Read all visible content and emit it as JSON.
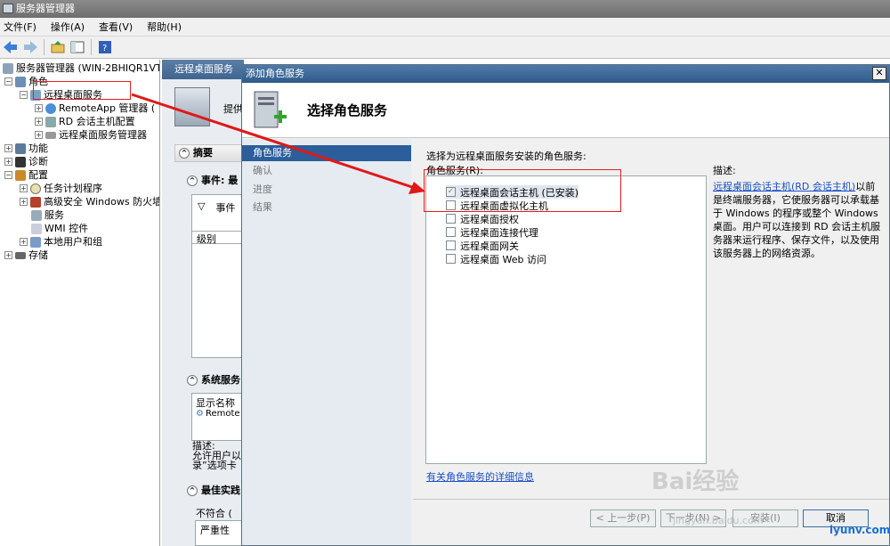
{
  "window": {
    "title": "服务器管理器"
  },
  "menu": [
    "文件(F)",
    "操作(A)",
    "查看(V)",
    "帮助(H)"
  ],
  "tree": {
    "root": "服务器管理器 (WIN-2BHIQR1VTC",
    "roles": "角色",
    "rds": "远程桌面服务",
    "remoteapp": "RemoteApp 管理器 (",
    "rdconfig": "RD 会话主机配置",
    "rdsmgr": "远程桌面服务管理器",
    "features": "功能",
    "diagnostics": "诊断",
    "config": "配置",
    "tasks": "任务计划程序",
    "firewall": "高级安全 Windows 防火墙",
    "services": "服务",
    "wmi": "WMI 控件",
    "localusers": "本地用户和组",
    "storage": "存储"
  },
  "middle": {
    "header": "远程桌面服务",
    "provide": "提供",
    "summary": "摘要",
    "events": "事件: 最",
    "events_filter": "事件",
    "level_col": "级别",
    "system_services": "系统服务",
    "display_name_col": "显示名称",
    "remote_item": "Remote",
    "desc_label": "描述:",
    "desc_line1": "允许用户以",
    "desc_line2": "录”选项卡",
    "best_practices": "最佳实践",
    "noncompliant": "不符合 (",
    "severity_col": "严重性"
  },
  "dialog": {
    "title": "添加角色服务",
    "header": "选择角色服务",
    "steps": [
      "角色服务",
      "确认",
      "进度",
      "结果"
    ],
    "instruction": "选择为远程桌面服务安装的角色服务:",
    "list_label": "角色服务(R):",
    "role_services": [
      {
        "label": "远程桌面会话主机 (已安装)",
        "checked": true,
        "disabled": true
      },
      {
        "label": "远程桌面虚拟化主机",
        "checked": false,
        "disabled": false
      },
      {
        "label": "远程桌面授权",
        "checked": false,
        "disabled": false
      },
      {
        "label": "远程桌面连接代理",
        "checked": false,
        "disabled": false
      },
      {
        "label": "远程桌面网关",
        "checked": false,
        "disabled": false
      },
      {
        "label": "远程桌面 Web 访问",
        "checked": false,
        "disabled": false
      }
    ],
    "desc_title": "描述:",
    "desc_link": "远程桌面会话主机(RD 会话主机)",
    "desc_text": "以前是终端服务器，它使服务器可以承载基于 Windows 的程序或整个 Windows 桌面。用户可以连接到 RD 会话主机服务器来运行程序、保存文件，以及使用该服务器上的网络资源。",
    "more_info_link": "有关角色服务的详细信息",
    "buttons": {
      "prev": "< 上一步(P)",
      "next": "下一步(N) >",
      "install": "安装(I)",
      "cancel": "取消"
    }
  },
  "watermark": {
    "text": "Bai经验",
    "sub": "jingyan.baidu.com",
    "site": "iyunv.com"
  }
}
